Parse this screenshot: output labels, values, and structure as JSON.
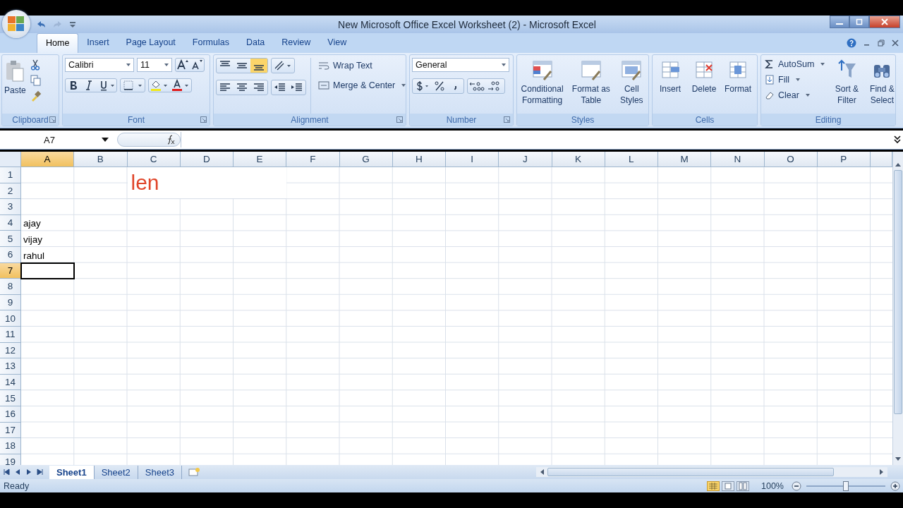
{
  "window": {
    "title": "New Microsoft Office Excel Worksheet (2) - Microsoft Excel"
  },
  "tabs": [
    {
      "label": "Home",
      "selected": true
    },
    {
      "label": "Insert",
      "selected": false
    },
    {
      "label": "Page Layout",
      "selected": false
    },
    {
      "label": "Formulas",
      "selected": false
    },
    {
      "label": "Data",
      "selected": false
    },
    {
      "label": "Review",
      "selected": false
    },
    {
      "label": "View",
      "selected": false
    }
  ],
  "ribbon": {
    "clipboard": {
      "label": "Clipboard",
      "paste": "Paste"
    },
    "font": {
      "label": "Font",
      "font_name": "Calibri",
      "font_size": "11"
    },
    "alignment": {
      "label": "Alignment",
      "wrap_text": "Wrap Text",
      "merge_center": "Merge & Center"
    },
    "number": {
      "label": "Number",
      "format": "General"
    },
    "styles": {
      "label": "Styles",
      "buttons": [
        "Conditional Formatting",
        "Format as Table",
        "Cell Styles"
      ]
    },
    "cells": {
      "label": "Cells",
      "buttons": [
        "Insert",
        "Delete",
        "Format"
      ]
    },
    "editing": {
      "label": "Editing",
      "small_buttons": [
        "AutoSum",
        "Fill",
        "Clear"
      ],
      "buttons": [
        "Sort & Filter",
        "Find & Select"
      ]
    }
  },
  "name_box": "A7",
  "columns": [
    {
      "label": "A",
      "selected": true
    },
    {
      "label": "B",
      "selected": false
    },
    {
      "label": "C",
      "selected": false
    },
    {
      "label": "D",
      "selected": false
    },
    {
      "label": "E",
      "selected": false
    },
    {
      "label": "F",
      "selected": false
    },
    {
      "label": "G",
      "selected": false
    },
    {
      "label": "H",
      "selected": false
    },
    {
      "label": "I",
      "selected": false
    },
    {
      "label": "J",
      "selected": false
    },
    {
      "label": "K",
      "selected": false
    },
    {
      "label": "L",
      "selected": false
    },
    {
      "label": "M",
      "selected": false
    },
    {
      "label": "N",
      "selected": false
    },
    {
      "label": "O",
      "selected": false
    },
    {
      "label": "P",
      "selected": false
    }
  ],
  "rows": [
    {
      "number": "1",
      "selected": false,
      "heading_cells": {
        "C": "len"
      }
    },
    {
      "number": "2",
      "selected": false
    },
    {
      "number": "3",
      "selected": false
    },
    {
      "number": "4",
      "selected": false,
      "cells": {
        "A": "ajay"
      }
    },
    {
      "number": "5",
      "selected": false,
      "cells": {
        "A": "vijay"
      }
    },
    {
      "number": "6",
      "selected": false,
      "cells": {
        "A": "rahul"
      }
    },
    {
      "number": "7",
      "selected": true
    },
    {
      "number": "8",
      "selected": false
    },
    {
      "number": "9",
      "selected": false
    },
    {
      "number": "10",
      "selected": false
    },
    {
      "number": "11",
      "selected": false
    },
    {
      "number": "12",
      "selected": false
    },
    {
      "number": "13",
      "selected": false
    },
    {
      "number": "14",
      "selected": false
    },
    {
      "number": "15",
      "selected": false
    },
    {
      "number": "16",
      "selected": false
    },
    {
      "number": "17",
      "selected": false
    },
    {
      "number": "18",
      "selected": false
    },
    {
      "number": "19",
      "selected": false
    }
  ],
  "sheets": [
    {
      "label": "Sheet1",
      "selected": true
    },
    {
      "label": "Sheet2",
      "selected": false
    },
    {
      "label": "Sheet3",
      "selected": false
    }
  ],
  "status_bar": {
    "status": "Ready",
    "zoom": "100%",
    "zoom_slider": {
      "level": 0.5
    }
  }
}
